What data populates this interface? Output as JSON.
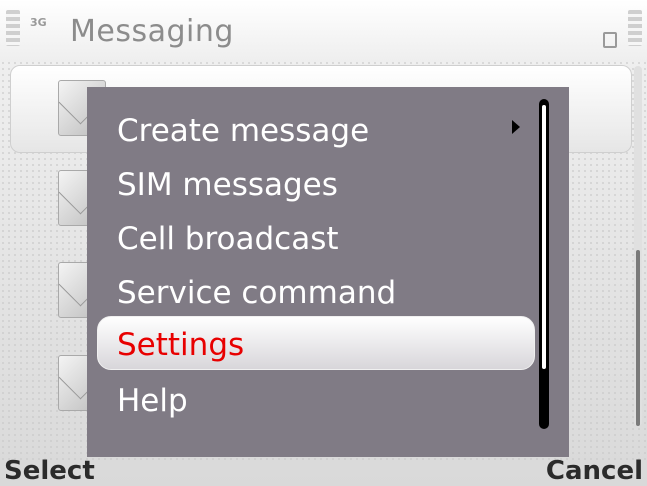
{
  "app": {
    "title": "Messaging",
    "net_indicator": "3G"
  },
  "menu": {
    "items": [
      {
        "label": "Create message",
        "has_submenu": true
      },
      {
        "label": "SIM messages"
      },
      {
        "label": "Cell broadcast"
      },
      {
        "label": "Service command"
      },
      {
        "label": "Settings",
        "selected": true
      },
      {
        "label": "Help"
      }
    ]
  },
  "softkeys": {
    "left": "Select",
    "right": "Cancel"
  },
  "colors": {
    "menu_bg": "#807b85",
    "selected_text": "#e80000",
    "menu_text": "#ffffff"
  }
}
